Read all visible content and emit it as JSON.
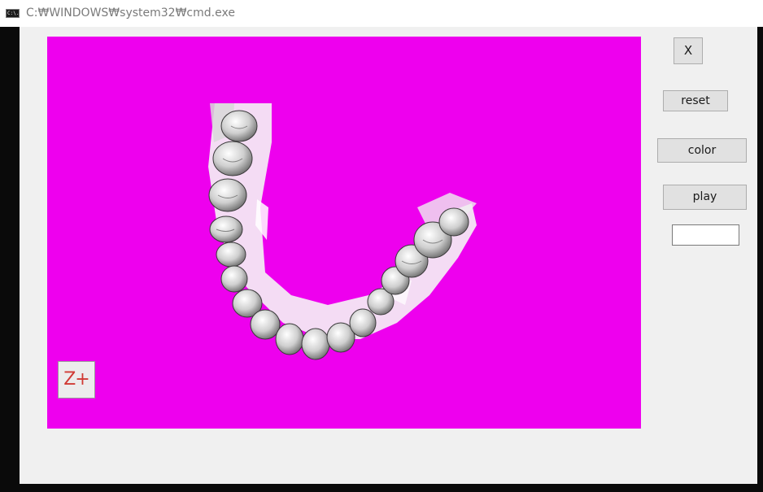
{
  "window": {
    "title": "C:₩WINDOWS₩system32₩cmd.exe",
    "icon": "cmd-console-icon",
    "icon_text": "C:\\."
  },
  "viewport": {
    "background_color": "#ee00ee",
    "content": "dental-arch-3d-scan",
    "zoom_button_label": "Z+"
  },
  "controls": {
    "close_label": "X",
    "reset_label": "reset",
    "color_label": "color",
    "play_label": "play",
    "input_value": ""
  }
}
